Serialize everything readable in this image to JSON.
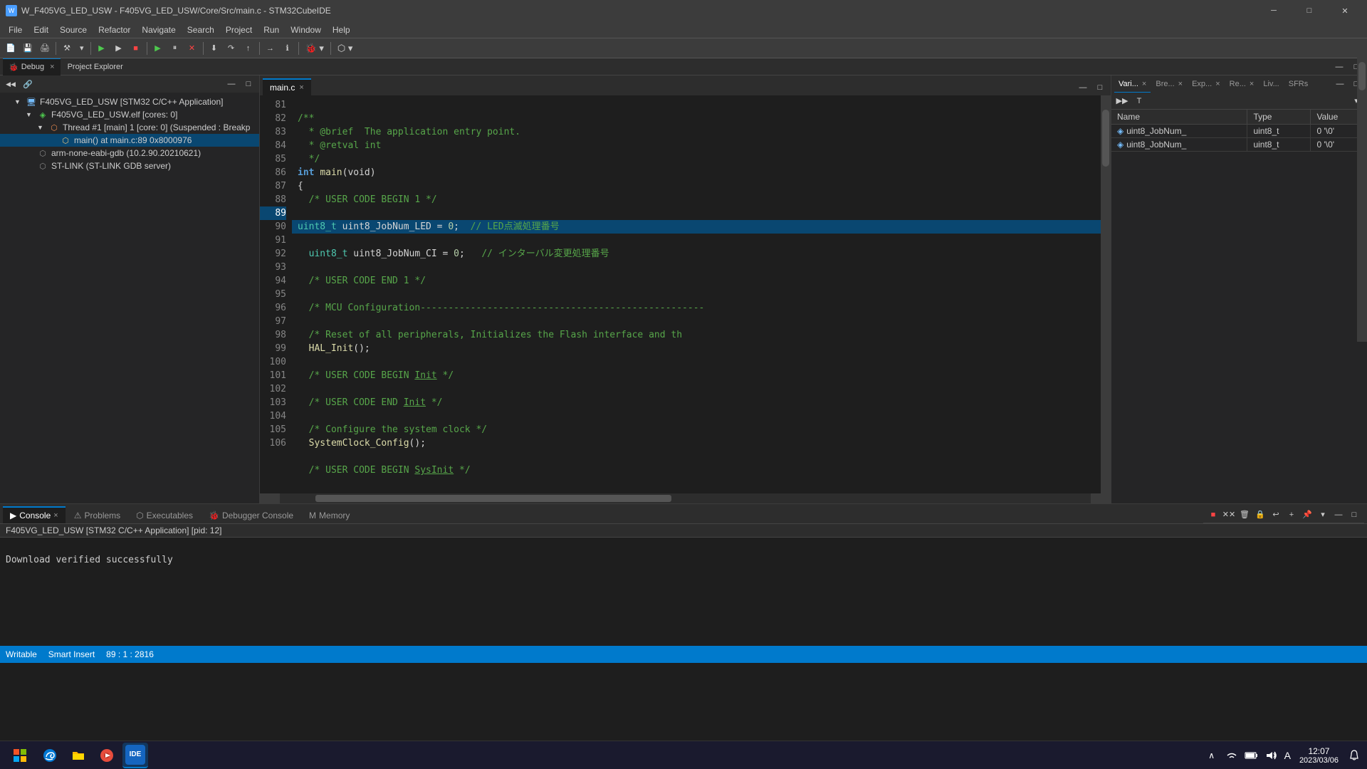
{
  "titleBar": {
    "icon": "W",
    "title": "W_F405VG_LED_USW - F405VG_LED_USW/Core/Src/main.c - STM32CubeIDE",
    "minimize": "─",
    "maximize": "□",
    "close": "✕"
  },
  "menuBar": {
    "items": [
      "File",
      "Edit",
      "Source",
      "Refactor",
      "Navigate",
      "Search",
      "Project",
      "Run",
      "Window",
      "Help"
    ]
  },
  "debugToolbar": {
    "debugTab": "Debug",
    "projectExplorerTab": "Project Explorer"
  },
  "editorTab": {
    "filename": "main.c",
    "close": "×"
  },
  "leftPanel": {
    "title": "Project Explorer",
    "tree": [
      {
        "indent": 0,
        "arrow": "▼",
        "icon": "🖥",
        "label": "F405VG_LED_USW [STM32 C/C++ Application]",
        "type": "root"
      },
      {
        "indent": 1,
        "arrow": "▼",
        "icon": "⬡",
        "label": "F405VG_LED_USW.elf [cores: 0]",
        "type": "elf"
      },
      {
        "indent": 2,
        "arrow": "▼",
        "icon": "⬡",
        "label": "Thread #1 [main] 1 [core: 0] (Suspended : Breakp",
        "type": "thread"
      },
      {
        "indent": 3,
        "arrow": "",
        "icon": "⬡",
        "label": "main() at main.c:89 0x8000976",
        "type": "frame"
      },
      {
        "indent": 1,
        "arrow": "",
        "icon": "⬡",
        "label": "arm-none-eabi-gdb (10.2.90.20210621)",
        "type": "gdb"
      },
      {
        "indent": 1,
        "arrow": "",
        "icon": "⬡",
        "label": "ST-LINK (ST-LINK GDB server)",
        "type": "stlink"
      }
    ]
  },
  "codeLines": [
    {
      "num": 81,
      "content": "/**",
      "type": "comment"
    },
    {
      "num": 82,
      "content": "  * @brief  The application entry point.",
      "type": "comment"
    },
    {
      "num": 83,
      "content": "  * @retval int",
      "type": "comment"
    },
    {
      "num": 84,
      "content": "  */",
      "type": "comment"
    },
    {
      "num": 85,
      "content": "int main(void)",
      "type": "keyword"
    },
    {
      "num": 86,
      "content": "{",
      "type": "normal"
    },
    {
      "num": 87,
      "content": "  /* USER CODE BEGIN 1 */",
      "type": "comment"
    },
    {
      "num": 88,
      "content": "",
      "type": "normal"
    },
    {
      "num": 89,
      "content": "  uint8_t uint8_JobNum_LED = 0;  // LED点滅処理番号",
      "type": "highlight"
    },
    {
      "num": 90,
      "content": "  uint8_t uint8_JobNum_CI = 0;   // インターバル変更処理番号",
      "type": "normal"
    },
    {
      "num": 91,
      "content": "",
      "type": "normal"
    },
    {
      "num": 92,
      "content": "  /* USER CODE END 1 */",
      "type": "comment"
    },
    {
      "num": 93,
      "content": "",
      "type": "normal"
    },
    {
      "num": 94,
      "content": "  /* MCU Configuration---------------------------------------------------",
      "type": "comment"
    },
    {
      "num": 95,
      "content": "",
      "type": "normal"
    },
    {
      "num": 96,
      "content": "  /* Reset of all peripherals, Initializes the Flash interface and th",
      "type": "comment"
    },
    {
      "num": 97,
      "content": "  HAL_Init();",
      "type": "normal"
    },
    {
      "num": 98,
      "content": "",
      "type": "normal"
    },
    {
      "num": 99,
      "content": "  /* USER CODE BEGIN Init */",
      "type": "comment"
    },
    {
      "num": 100,
      "content": "",
      "type": "normal"
    },
    {
      "num": 101,
      "content": "  /* USER CODE END Init */",
      "type": "comment"
    },
    {
      "num": 102,
      "content": "",
      "type": "normal"
    },
    {
      "num": 103,
      "content": "  /* Configure the system clock */",
      "type": "comment"
    },
    {
      "num": 104,
      "content": "  SystemClock_Config();",
      "type": "normal"
    },
    {
      "num": 105,
      "content": "",
      "type": "normal"
    },
    {
      "num": 106,
      "content": "  /* USER CODE BEGIN SysInit */",
      "type": "comment"
    }
  ],
  "rightPanel": {
    "tabs": [
      "Vari...",
      "Bre...",
      "Exp...",
      "Re...",
      "Liv...",
      "SFRs"
    ],
    "columns": [
      "Name",
      "Type",
      "Value"
    ],
    "rows": [
      {
        "name": "uint8_JobNum_",
        "type": "uint8_t",
        "value": "0 '\\0'"
      },
      {
        "name": "uint8_JobNum_",
        "type": "uint8_t",
        "value": "0 '\\0'"
      }
    ]
  },
  "bottomPanel": {
    "tabs": [
      "Console",
      "Problems",
      "Executables",
      "Debugger Console",
      "Memory"
    ],
    "consoleTitle": "F405VG_LED_USW [STM32 C/C++ Application] [pid: 12]",
    "consoleContent": "Download verified successfully"
  },
  "statusBar": {
    "writable": "Writable",
    "smartInsert": "Smart Insert",
    "position": "89 : 1 : 2816"
  },
  "taskbar": {
    "time": "12:07",
    "date": "2023/03/06",
    "apps": [
      "⊞",
      "🌐",
      "📁",
      "🎵",
      "IDE"
    ]
  }
}
